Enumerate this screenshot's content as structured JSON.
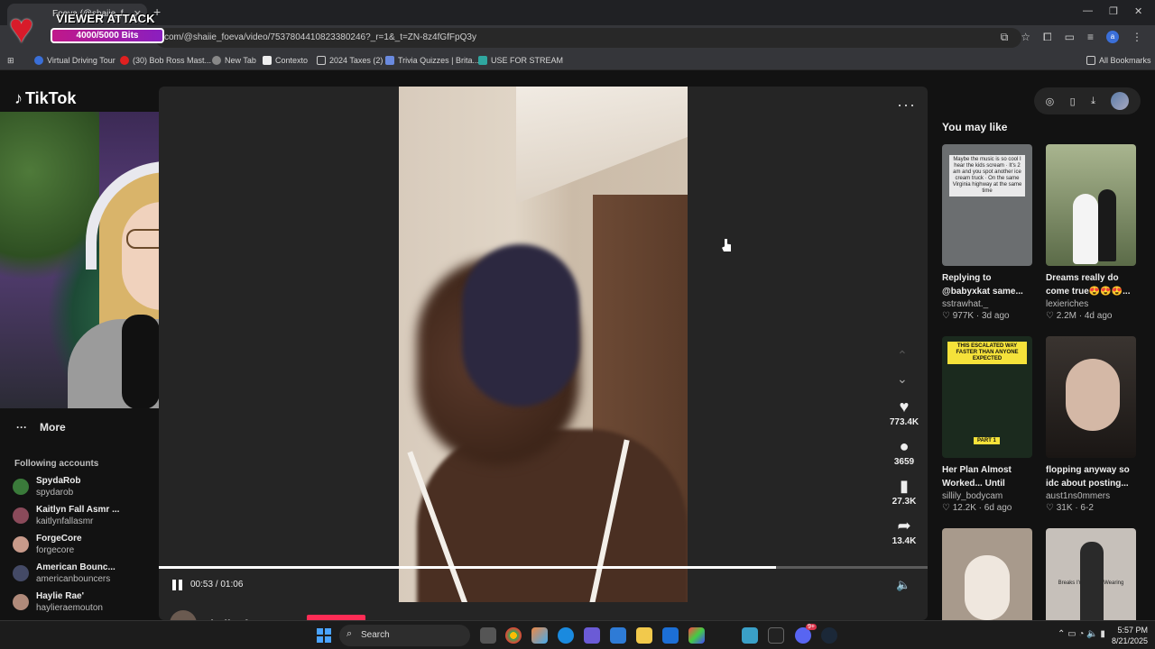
{
  "browser": {
    "tab_title": "Foeva (@shaiie_f...",
    "url": "com/@shaiie_foeva/video/7537804410823380246?_r=1&_t=ZN-8z4fGfFpQ3y",
    "bookmarks": [
      {
        "label": "Virtual Driving Tour"
      },
      {
        "label": "(30) Bob Ross Mast..."
      },
      {
        "label": "New Tab"
      },
      {
        "label": "Contexto"
      },
      {
        "label": "2024 Taxes (2)"
      },
      {
        "label": "Trivia Quizzes | Brita..."
      },
      {
        "label": "USE FOR STREAM"
      }
    ],
    "all_bookmarks": "All Bookmarks",
    "profile_letter": "a"
  },
  "overlay": {
    "title": "VIEWER ATTACK",
    "bits": "4000/5000 Bits",
    "bits_progress": 0.8
  },
  "tiktok": {
    "logo": "TikTok",
    "more": "More",
    "following_title": "Following accounts",
    "accounts": [
      {
        "name": "SpydaRob",
        "handle": "spydarob",
        "color": "#3a7a3a"
      },
      {
        "name": "Kaitlyn Fall Asmr ...",
        "handle": "kaitlynfallasmr",
        "color": "#8a4a5a"
      },
      {
        "name": "ForgeCore",
        "handle": "forgecore",
        "color": "#c89a8a"
      },
      {
        "name": "American Bounc...",
        "handle": "americanbouncers",
        "color": "#444a66"
      },
      {
        "name": "Haylie Rae'",
        "handle": "haylieraemouton",
        "color": "#b08a7a"
      }
    ],
    "video": {
      "likes": "773.4K",
      "comments": "3659",
      "saves": "27.3K",
      "shares": "13.4K",
      "time": "00:53 / 01:06",
      "progress": 0.803,
      "author": "shaiie_foeva"
    },
    "you_may_like": "You may like",
    "recommendations": [
      {
        "title": "Replying to @babyxkat same...",
        "author": "sstrawhat._",
        "stats": "♡ 977K · 3d ago",
        "thumb_text": "Maybe the music is so cool I hear the kids scream · It's 2 am and you spot another ice cream truck · On the same Virginia highway at the same time",
        "bg": "#6b6e70"
      },
      {
        "title": "Dreams really do come true😍😍😍...",
        "author": "lexieriches",
        "stats": "♡ 2.2M · 4d ago",
        "thumb_text": "",
        "bg": "#7d8a6a"
      },
      {
        "title": "Her Plan Almost Worked... Until This...",
        "author": "sillily_bodycam",
        "stats": "♡ 12.2K · 6d ago",
        "thumb_text": "THIS ESCALATED WAY FASTER THAN ANYONE EXPECTED",
        "part": "PART 1",
        "bg": "#1b2a1e"
      },
      {
        "title": "flopping anyway so idc about posting...",
        "author": "aust1ns0mmers",
        "stats": "♡ 31K · 6-2",
        "thumb_text": "",
        "bg": "#2a2522"
      },
      {
        "title": "",
        "author": "",
        "stats": "",
        "thumb_text": "",
        "bg": "#a89a8c"
      },
      {
        "title": "",
        "author": "",
        "stats": "",
        "thumb_text": "Breaks I'm Kinda · Wearing",
        "bg": "#c6c0ba"
      }
    ]
  },
  "taskbar": {
    "search": "Search",
    "time": "5:57 PM",
    "date": "8/21/2025",
    "discord_badge": "9+"
  }
}
